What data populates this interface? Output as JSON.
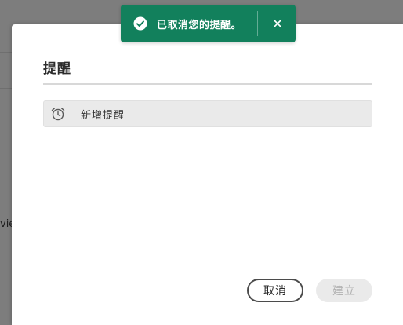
{
  "background": {
    "partial_text": "viet"
  },
  "dialog": {
    "title": "提醒",
    "add_reminder_label": "新增提醒",
    "cancel_label": "取消",
    "create_label": "建立"
  },
  "toast": {
    "message": "已取消您的提醒。",
    "background_color": "#12805c"
  },
  "icons": {
    "toast_status": "check-circle-icon",
    "toast_close": "close-icon",
    "add_reminder": "alarm-clock-icon"
  }
}
